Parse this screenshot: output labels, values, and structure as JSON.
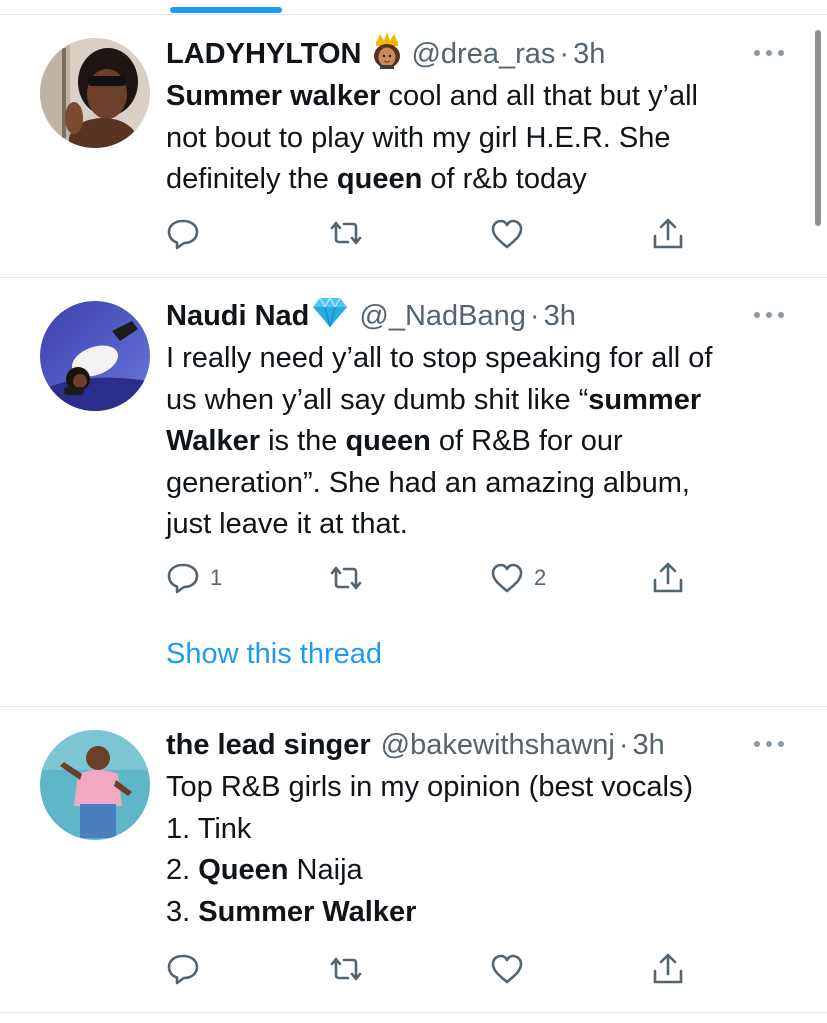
{
  "colors": {
    "accent": "#1d9bf0",
    "text": "#0f1419",
    "secondary": "#536471"
  },
  "tweets": [
    {
      "name": "LADYHYLTON",
      "badge": "crown-woman-emoji",
      "handle": "@drea_ras",
      "separator": "·",
      "time": "3h",
      "lines": [
        [
          {
            "t": "Summer walker",
            "b": true
          },
          {
            "t": " cool and all that but y’all",
            "b": false
          }
        ],
        [
          {
            "t": "not bout to play with my girl H.E.R. She",
            "b": false
          }
        ],
        [
          {
            "t": "definitely the ",
            "b": false
          },
          {
            "t": "queen",
            "b": true
          },
          {
            "t": " of r&b today",
            "b": false
          }
        ]
      ],
      "reply_count": "",
      "like_count": ""
    },
    {
      "name": "Naudi Nad",
      "badge": "gem-emoji",
      "handle": "@_NadBang",
      "separator": "·",
      "time": "3h",
      "lines": [
        [
          {
            "t": "I really need y’all to stop speaking for all of",
            "b": false
          }
        ],
        [
          {
            "t": "us when y’all say dumb shit like “",
            "b": false
          },
          {
            "t": "summer",
            "b": true
          }
        ],
        [
          {
            "t": "Walker",
            "b": true
          },
          {
            "t": " is the ",
            "b": false
          },
          {
            "t": "queen",
            "b": true
          },
          {
            "t": " of R&B for our",
            "b": false
          }
        ],
        [
          {
            "t": "generation”. She had an amazing album,",
            "b": false
          }
        ],
        [
          {
            "t": "just leave it at that.",
            "b": false
          }
        ]
      ],
      "reply_count": "1",
      "like_count": "2",
      "show_thread": "Show this thread"
    },
    {
      "name": "the lead singer",
      "badge": "",
      "handle": "@bakewithshawnj",
      "separator": "·",
      "time": "3h",
      "lines": [
        [
          {
            "t": "Top R&B girls in my opinion (best vocals)",
            "b": false
          }
        ],
        [
          {
            "t": "1. Tink",
            "b": false
          }
        ],
        [
          {
            "t": "2. ",
            "b": false
          },
          {
            "t": "Queen",
            "b": true
          },
          {
            "t": " Naija",
            "b": false
          }
        ],
        [
          {
            "t": "3. ",
            "b": false
          },
          {
            "t": "Summer Walker",
            "b": true
          }
        ]
      ],
      "reply_count": "",
      "like_count": ""
    }
  ]
}
